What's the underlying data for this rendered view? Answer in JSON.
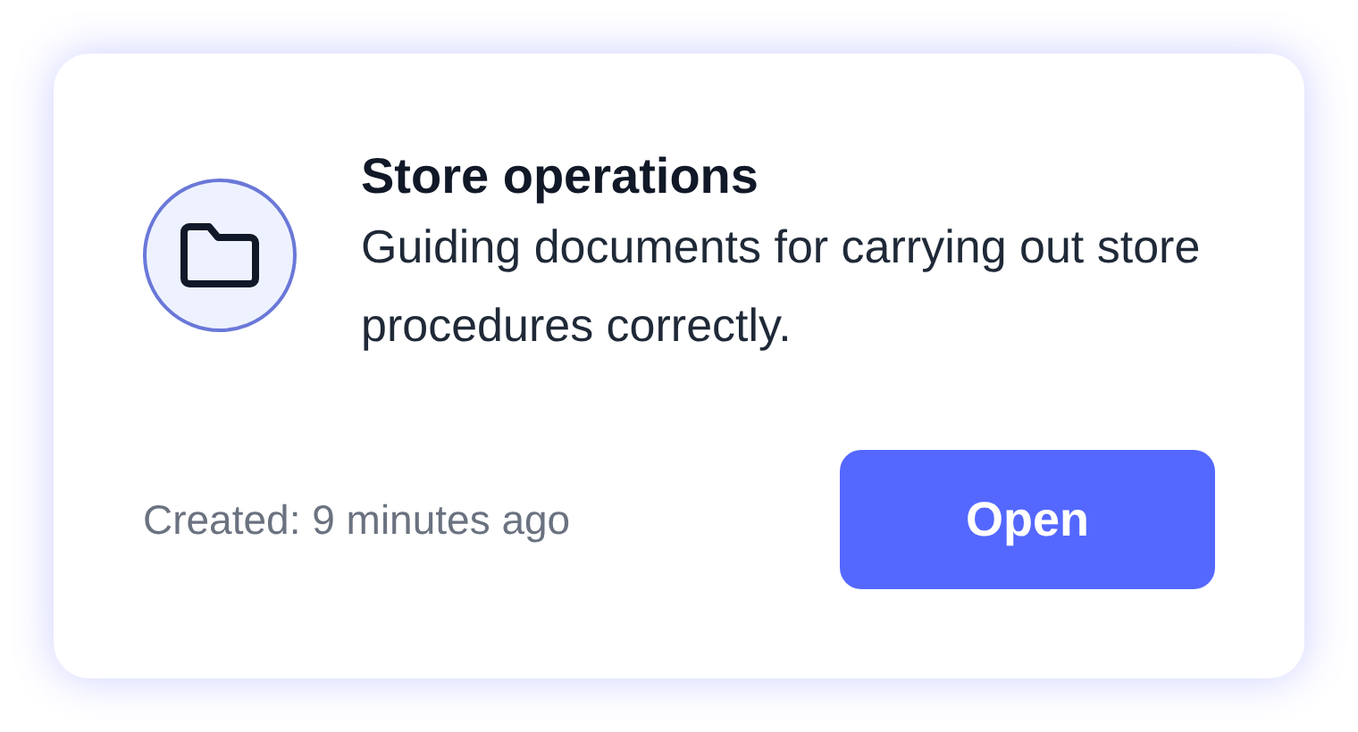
{
  "card": {
    "title": "Store operations",
    "description": "Guiding documents for carrying out store procedures correctly.",
    "created": "Created: 9 minutes ago",
    "button": "Open"
  }
}
